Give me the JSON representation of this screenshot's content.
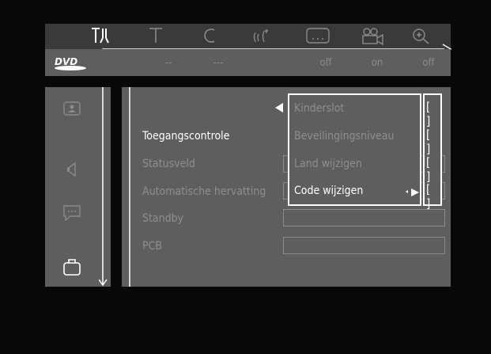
{
  "top_icons": [
    {
      "name": "settings-icon",
      "glyph": "T⅄",
      "active": true
    },
    {
      "name": "title-icon",
      "glyph": "T",
      "active": false
    },
    {
      "name": "chapter-icon",
      "glyph": "C",
      "active": false
    },
    {
      "name": "audio-icon",
      "glyph": "((ʻ̓",
      "active": false
    },
    {
      "name": "subtitle-icon",
      "glyph": "…",
      "active": false
    },
    {
      "name": "angle-camera-icon",
      "glyph": "⊞",
      "active": false
    },
    {
      "name": "zoom-icon",
      "glyph": "⊕",
      "active": false
    }
  ],
  "status_values": [
    "--",
    "---",
    "off",
    "on",
    "off"
  ],
  "logo": "DVD",
  "menu_items": [
    {
      "label": "Toegangscontrole",
      "active": true
    },
    {
      "label": "Statusveld",
      "active": false
    },
    {
      "label": "Automatische hervatting",
      "active": false
    },
    {
      "label": "Standby",
      "active": false
    },
    {
      "label": "PCB",
      "active": false
    }
  ],
  "popup_items": [
    {
      "label": "Kinderslot",
      "active": false
    },
    {
      "label": "Beveilingingsniveau",
      "active": false
    },
    {
      "label": "Land wijzigen",
      "active": false
    },
    {
      "label": "Code wijzigen",
      "active": true
    }
  ],
  "checkbox_glyph": "[ ]",
  "colors": {
    "background": "#080808",
    "panel": "#5e5e5e",
    "bar": "#3a3a3a",
    "text_active": "#ffffff",
    "text_dim": "#8e8e8e"
  }
}
